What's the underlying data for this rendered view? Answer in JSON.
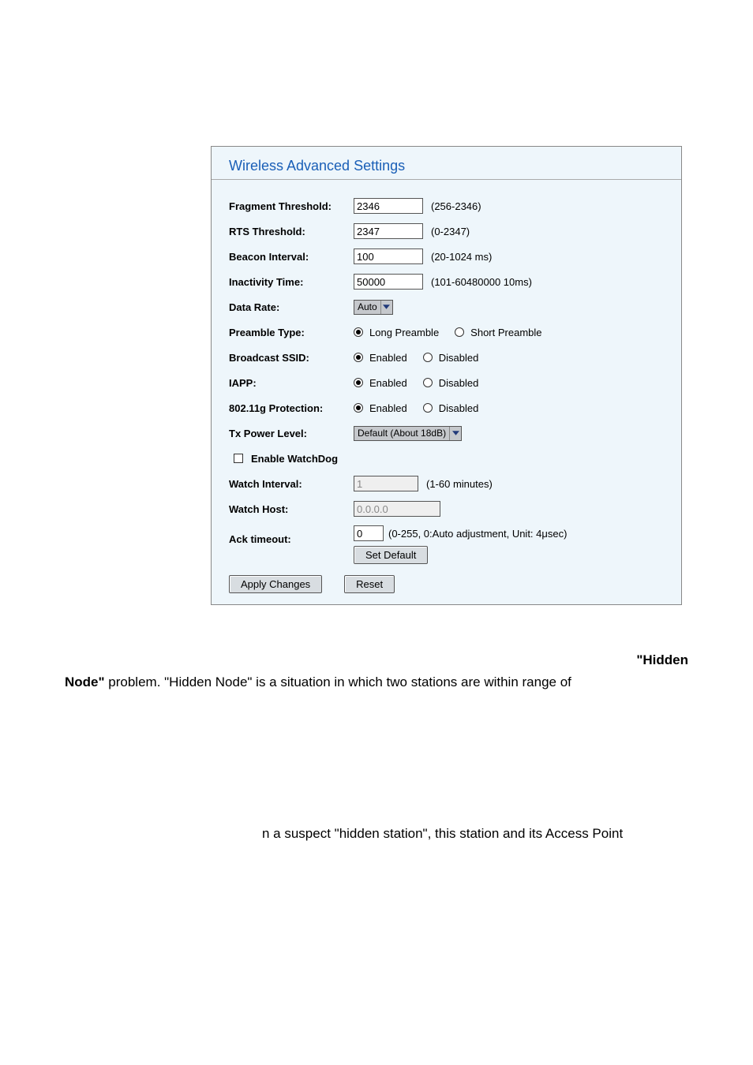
{
  "panel": {
    "title": "Wireless Advanced Settings",
    "fragment_threshold": {
      "label": "Fragment Threshold:",
      "value": "2346",
      "hint": "(256-2346)"
    },
    "rts_threshold": {
      "label": "RTS Threshold:",
      "value": "2347",
      "hint": "(0-2347)"
    },
    "beacon_interval": {
      "label": "Beacon Interval:",
      "value": "100",
      "hint": "(20-1024 ms)"
    },
    "inactivity_time": {
      "label": "Inactivity Time:",
      "value": "50000",
      "hint": "(101-60480000 10ms)"
    },
    "data_rate": {
      "label": "Data Rate:",
      "value": "Auto"
    },
    "preamble_type": {
      "label": "Preamble Type:",
      "opt1": "Long Preamble",
      "opt2": "Short Preamble"
    },
    "broadcast_ssid": {
      "label": "Broadcast SSID:",
      "opt1": "Enabled",
      "opt2": "Disabled"
    },
    "iapp": {
      "label": "IAPP:",
      "opt1": "Enabled",
      "opt2": "Disabled"
    },
    "g_protection": {
      "label": "802.11g Protection:",
      "opt1": "Enabled",
      "opt2": "Disabled"
    },
    "tx_power": {
      "label": "Tx Power Level:",
      "value": "Default (About 18dB)"
    },
    "enable_watchdog": {
      "label": "Enable WatchDog"
    },
    "watch_interval": {
      "label": "Watch Interval:",
      "value": "1",
      "hint": "(1-60 minutes)"
    },
    "watch_host": {
      "label": "Watch Host:",
      "value": "0.0.0.0"
    },
    "ack_timeout": {
      "label": "Ack timeout:",
      "value": "0",
      "hint": "(0-255, 0:Auto adjustment, Unit: 4μsec)",
      "set_default": "Set Default"
    },
    "apply": "Apply Changes",
    "reset": "Reset"
  },
  "body": {
    "hidden_label": "\"Hidden",
    "node_bold": "Node\"",
    "node_rest": " problem. \"Hidden Node\" is a situation in which two stations are within range of",
    "frag2": "n a suspect \"hidden station\", this station and its Access Point"
  }
}
